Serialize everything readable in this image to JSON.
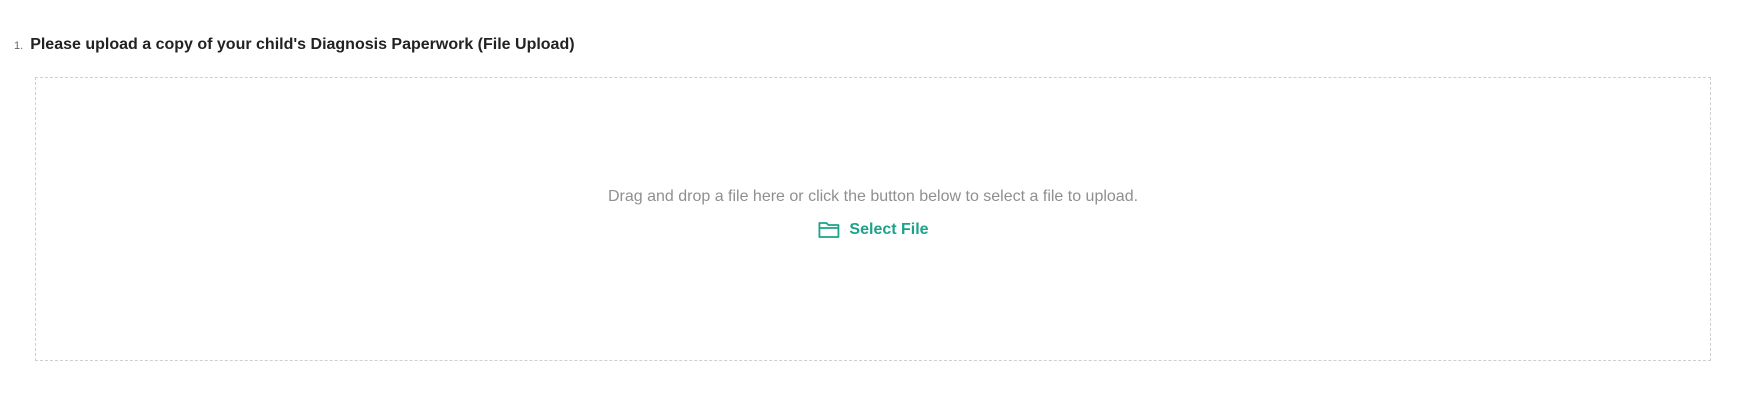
{
  "question": {
    "number": "1.",
    "label": "Please upload a copy of your child's Diagnosis Paperwork (File Upload)"
  },
  "dropzone": {
    "hint": "Drag and drop a file here or click the button below to select a file to upload.",
    "select_button_label": "Select File",
    "select_button_icon": "folder-open-icon",
    "accent_color": "#1ba38a"
  }
}
